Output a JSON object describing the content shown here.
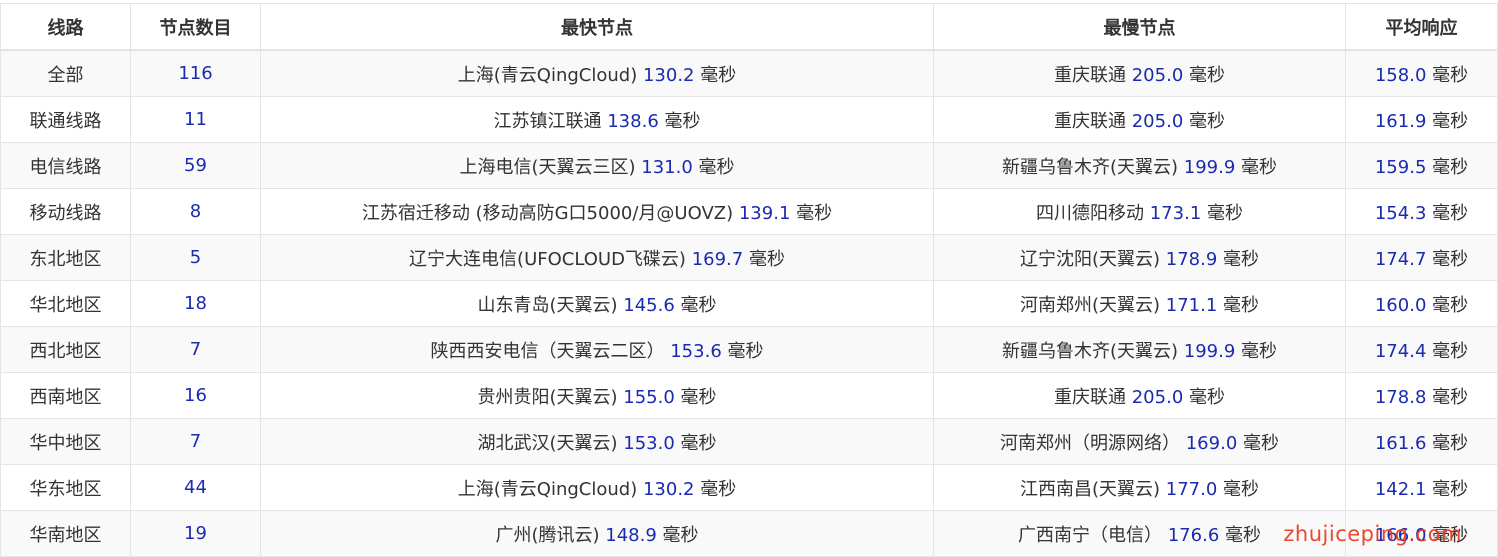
{
  "table": {
    "headers": [
      "线路",
      "节点数目",
      "最快节点",
      "最慢节点",
      "平均响应"
    ],
    "unit": "毫秒",
    "rows": [
      {
        "line": "全部",
        "count": "116",
        "fast_name": "上海(青云QingCloud)",
        "fast_ms": "130.2",
        "slow_name": "重庆联通",
        "slow_ms": "205.0",
        "avg_ms": "158.0"
      },
      {
        "line": "联通线路",
        "count": "11",
        "fast_name": "江苏镇江联通",
        "fast_ms": "138.6",
        "slow_name": "重庆联通",
        "slow_ms": "205.0",
        "avg_ms": "161.9"
      },
      {
        "line": "电信线路",
        "count": "59",
        "fast_name": "上海电信(天翼云三区)",
        "fast_ms": "131.0",
        "slow_name": "新疆乌鲁木齐(天翼云)",
        "slow_ms": "199.9",
        "avg_ms": "159.5"
      },
      {
        "line": "移动线路",
        "count": "8",
        "fast_name": "江苏宿迁移动 (移动高防G口5000/月@UOVZ)",
        "fast_ms": "139.1",
        "slow_name": "四川德阳移动",
        "slow_ms": "173.1",
        "avg_ms": "154.3"
      },
      {
        "line": "东北地区",
        "count": "5",
        "fast_name": "辽宁大连电信(UFOCLOUD飞碟云)",
        "fast_ms": "169.7",
        "slow_name": "辽宁沈阳(天翼云)",
        "slow_ms": "178.9",
        "avg_ms": "174.7"
      },
      {
        "line": "华北地区",
        "count": "18",
        "fast_name": "山东青岛(天翼云)",
        "fast_ms": "145.6",
        "slow_name": "河南郑州(天翼云)",
        "slow_ms": "171.1",
        "avg_ms": "160.0"
      },
      {
        "line": "西北地区",
        "count": "7",
        "fast_name": "陕西西安电信（天翼云二区）",
        "fast_ms": "153.6",
        "slow_name": "新疆乌鲁木齐(天翼云)",
        "slow_ms": "199.9",
        "avg_ms": "174.4"
      },
      {
        "line": "西南地区",
        "count": "16",
        "fast_name": "贵州贵阳(天翼云)",
        "fast_ms": "155.0",
        "slow_name": "重庆联通",
        "slow_ms": "205.0",
        "avg_ms": "178.8"
      },
      {
        "line": "华中地区",
        "count": "7",
        "fast_name": "湖北武汉(天翼云)",
        "fast_ms": "153.0",
        "slow_name": "河南郑州（明源网络）",
        "slow_ms": "169.0",
        "avg_ms": "161.6"
      },
      {
        "line": "华东地区",
        "count": "44",
        "fast_name": "上海(青云QingCloud)",
        "fast_ms": "130.2",
        "slow_name": "江西南昌(天翼云)",
        "slow_ms": "177.0",
        "avg_ms": "142.1"
      },
      {
        "line": "华南地区",
        "count": "19",
        "fast_name": "广州(腾讯云)",
        "fast_ms": "148.9",
        "slow_name": "广西南宁（电信）",
        "slow_ms": "176.6",
        "avg_ms": "166.0"
      }
    ]
  },
  "watermark": "zhujiceping.com",
  "colors": {
    "number_text": "#1a2bb0",
    "body_text": "#333333",
    "stripe": "#f9f9f9",
    "border": "#e4e4e4",
    "watermark": "#e83a1f"
  }
}
